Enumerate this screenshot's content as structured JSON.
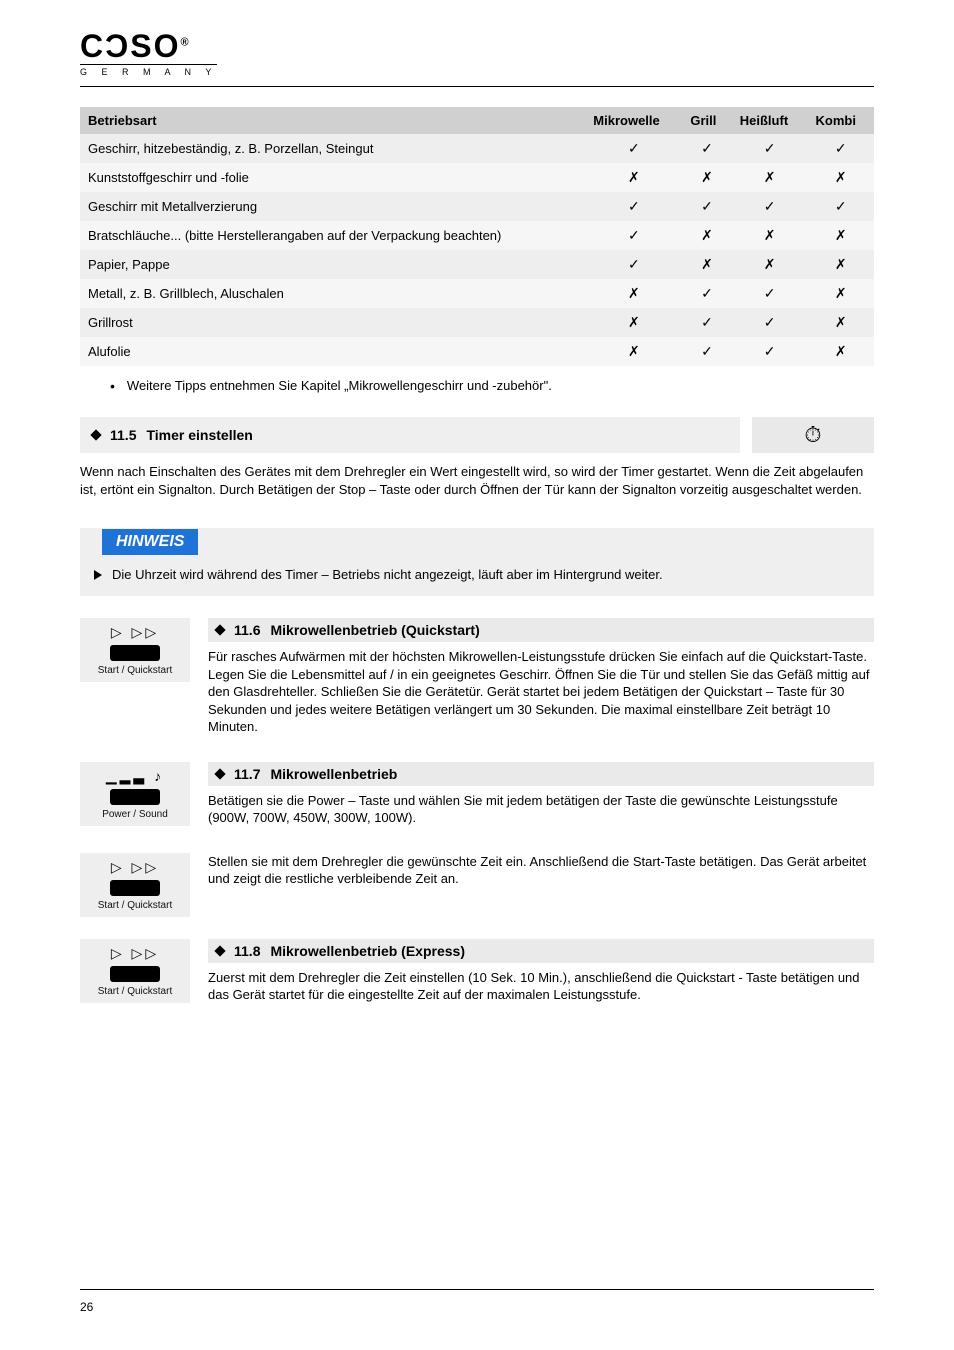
{
  "logo": {
    "brand": "CƆSO",
    "sub": "G E R M A N Y",
    "reg": "®"
  },
  "table": {
    "headers": [
      "Betriebsart",
      "Mikrowelle",
      "Grill",
      "Heißluft",
      "Kombi"
    ],
    "col0": "Betriebsart",
    "col1": "Mikrowelle",
    "col2": "Grill",
    "col3": "Heißluft",
    "col4": "Kombi",
    "rows": [
      {
        "label": "Geschirr, hitzebeständig, z. B. Porzellan, Steingut",
        "c": [
          "✓",
          "✓",
          "✓",
          "✓"
        ]
      },
      {
        "label": "Kunststoffgeschirr und -folie",
        "c": [
          "✗",
          "✗",
          "✗",
          "✗"
        ]
      },
      {
        "label": "Geschirr mit Metallverzierung",
        "c": [
          "✓",
          "✓",
          "✓",
          "✓"
        ]
      },
      {
        "label": "Bratschläuche... (bitte Herstellerangaben auf der Verpackung beachten)",
        "c": [
          "✓",
          "✗",
          "✗",
          "✗"
        ]
      },
      {
        "label": "Papier, Pappe",
        "c": [
          "✓",
          "✗",
          "✗",
          "✗"
        ]
      },
      {
        "label": "Metall, z. B. Grillblech, Aluschalen",
        "c": [
          "✗",
          "✓",
          "✓",
          "✗"
        ]
      },
      {
        "label": "Grillrost",
        "c": [
          "✗",
          "✓",
          "✓",
          "✗"
        ]
      },
      {
        "label": "Alufolie",
        "c": [
          "✗",
          "✓",
          "✓",
          "✗"
        ]
      }
    ]
  },
  "bullet": "Weitere Tipps entnehmen Sie Kapitel „Mikrowellengeschirr und -zubehör\".",
  "timer": {
    "section_num": "11.5",
    "numLabel": "11.5",
    "title": "Timer einstellen",
    "iconGlyph": "⏱"
  },
  "timer_para": "Wenn nach Einschalten des Gerätes mit dem Drehregler ein Wert eingestellt wird, so wird der Timer gestartet. Wenn die Zeit abgelaufen ist, ertönt ein Signalton. Durch Betätigen der Stop – Taste oder durch Öffnen der Tür kann der Signalton vorzeitig ausgeschaltet werden.",
  "hinweisLabel": "HINWEIS",
  "hinweisText": "Die Uhrzeit wird während des Timer – Betriebs nicht angezeigt, läuft aber im Hintergrund weiter.",
  "sec116": {
    "num": "11.6",
    "title": "Mikrowellenbetrieb (Quickstart)",
    "p1": "Für rasches Aufwärmen mit der höchsten Mikrowellen-Leistungsstufe drücken Sie einfach auf die Quickstart-Taste. Legen Sie die Lebensmittel auf / in ein geeignetes Geschirr. Öffnen Sie die Tür und stellen Sie das Gefäß mittig auf den Glasdrehteller. Schließen Sie die Gerätetür. Gerät startet bei jedem Betätigen der Quickstart – Taste für 30 Sekunden und jedes weitere Betätigen verlängert um 30 Sekunden. Die maximal einstellbare Zeit beträgt 10 Minuten.",
    "cap": "Start / Quickstart"
  },
  "sec117": {
    "num": "11.7",
    "title": "Mikrowellenbetrieb",
    "p1": "Betätigen sie die Power – Taste und wählen Sie mit jedem betätigen der Taste die gewünschte Leistungsstufe (900W, 700W, 450W, 300W, 100W).",
    "cap": "Power / Sound"
  },
  "sec117b": {
    "p1": "Stellen sie mit dem Drehregler die gewünschte Zeit ein. Anschließend die Start-Taste betätigen. Das Gerät arbeitet und zeigt die restliche verbleibende Zeit an.",
    "cap": "Start / Quickstart"
  },
  "sec118": {
    "num": "11.8",
    "title": "Mikrowellenbetrieb (Express)",
    "p1": "Zuerst mit dem Drehregler die Zeit einstellen (10 Sek. 10 Min.), anschließend die Quickstart - Taste betätigen und das Gerät startet für die eingestellte Zeit auf der maximalen Leistungsstufe.",
    "cap": "Start / Quickstart"
  },
  "pageNumber": "26"
}
